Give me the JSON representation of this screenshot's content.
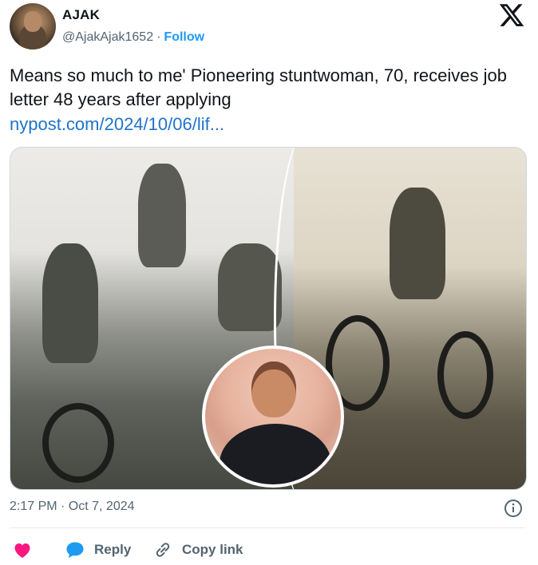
{
  "user": {
    "name": "AJAK",
    "handle": "@AjakAjak1652",
    "separator": "·",
    "follow_label": "Follow"
  },
  "tweet": {
    "text": "Means so much to me' Pioneering stuntwoman, 70, receives job letter 48 years after applying",
    "link": "nypost.com/2024/10/06/lif..."
  },
  "meta": {
    "timestamp": "2:17 PM · Oct 7, 2024"
  },
  "actions": {
    "like_label": "",
    "reply_label": "Reply",
    "copy_link_label": "Copy link"
  },
  "icons": {
    "x_logo": "x-logo-icon",
    "info": "info-icon",
    "heart": "heart-icon",
    "reply": "reply-bubble-icon",
    "copy_link": "link-icon"
  },
  "colors": {
    "accent": "#1d9bf0",
    "link": "#1d74c9",
    "like": "#f91880",
    "muted": "#536471"
  }
}
